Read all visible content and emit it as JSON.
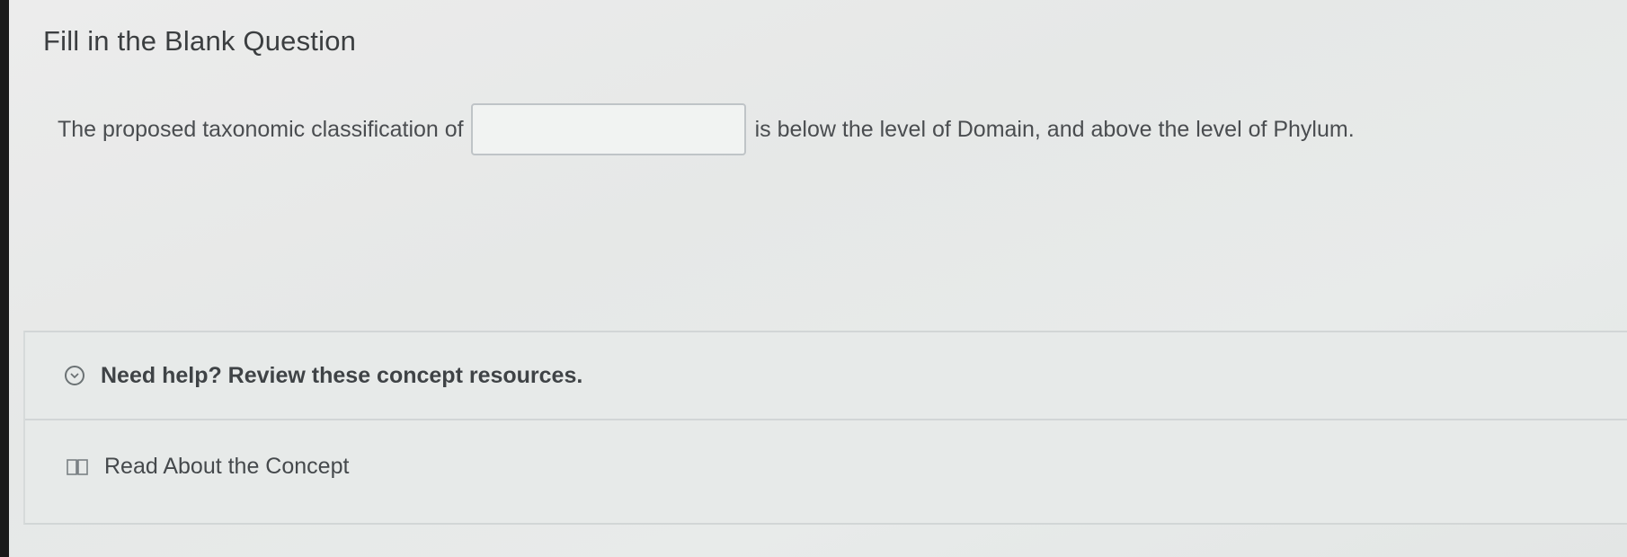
{
  "question": {
    "title": "Fill in the Blank Question",
    "text_before": "The proposed taxonomic classification of",
    "text_after": "is below the level of Domain, and above the level of Phylum.",
    "blank_value": ""
  },
  "help": {
    "toggle_label": "Need help? Review these concept resources.",
    "toggle_icon": "chevron-down-circle-icon",
    "resources": [
      {
        "label": "Read About the Concept",
        "icon": "book-icon"
      }
    ]
  },
  "colors": {
    "background": "#e9ebea",
    "text": "#3a3d3f",
    "border": "#d2d6d6"
  }
}
